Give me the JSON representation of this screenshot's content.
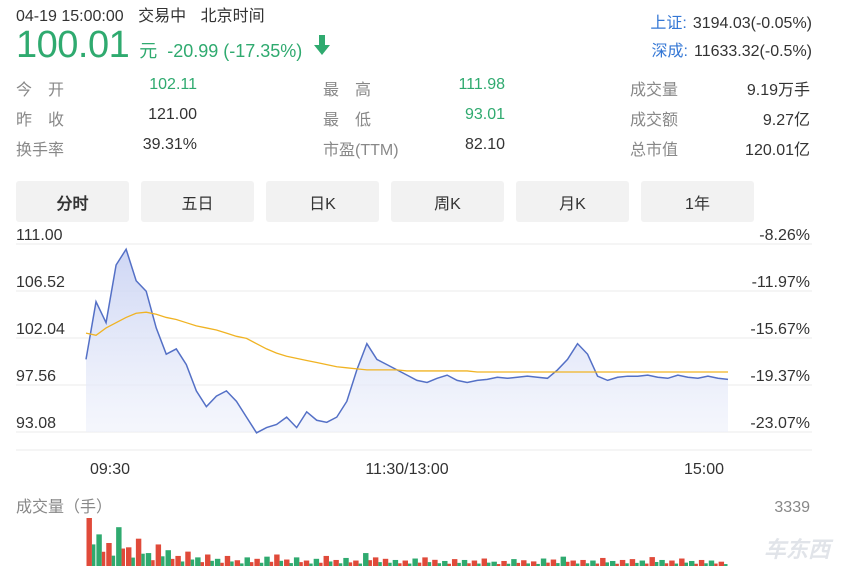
{
  "header": {
    "date_time": "04-19 15:00:00",
    "status": "交易中",
    "timezone": "北京时间",
    "price": "100.01",
    "unit": "元",
    "change": "-20.99 (-17.35%)"
  },
  "indices": [
    {
      "name": "上证:",
      "value": "3194.03(-0.05%)"
    },
    {
      "name": "深成:",
      "value": "11633.32(-0.5%)"
    }
  ],
  "stats": [
    {
      "label": "今　开",
      "value": "102.11",
      "color": "green"
    },
    {
      "label": "最　高",
      "value": "111.98",
      "color": "green"
    },
    {
      "label": "成交量",
      "value": "9.19万手",
      "color": "dark"
    },
    {
      "label": "昨　收",
      "value": "121.00",
      "color": "dark"
    },
    {
      "label": "最　低",
      "value": "93.01",
      "color": "green"
    },
    {
      "label": "成交额",
      "value": "9.27亿",
      "color": "dark"
    },
    {
      "label": "换手率",
      "value": "39.31%",
      "color": "dark"
    },
    {
      "label": "市盈(TTM)",
      "value": "82.10",
      "color": "dark"
    },
    {
      "label": "总市值",
      "value": "120.01亿",
      "color": "dark"
    }
  ],
  "tabs": [
    "分时",
    "五日",
    "日K",
    "周K",
    "月K",
    "1年"
  ],
  "active_tab": 0,
  "chart_data": {
    "type": "line",
    "y_left_ticks": [
      "111.00",
      "106.52",
      "102.04",
      "97.56",
      "93.08"
    ],
    "y_right_ticks": [
      "-8.26%",
      "-11.97%",
      "-15.67%",
      "-19.37%",
      "-23.07%"
    ],
    "ylim": [
      93.08,
      111.0
    ],
    "x_ticks": [
      "09:30",
      "11:30/13:00",
      "15:00"
    ],
    "series": [
      {
        "color": "#5470c6",
        "x": [
          0,
          1,
          2,
          3,
          4,
          5,
          6,
          7,
          8,
          9,
          10,
          11,
          12,
          13,
          14,
          15,
          16,
          17,
          18,
          19,
          20,
          21,
          22,
          23,
          24,
          25,
          26,
          27,
          28,
          29,
          30,
          31,
          32,
          33,
          34,
          35,
          36,
          37,
          38,
          39,
          40,
          41,
          42,
          43,
          44,
          45,
          46,
          47,
          48,
          49,
          50,
          51,
          52,
          53,
          54,
          55,
          56,
          57,
          58,
          59,
          60,
          61,
          62,
          63,
          64
        ],
        "y": [
          100.0,
          105.5,
          103.5,
          109.0,
          110.5,
          107.5,
          106.5,
          103.0,
          100.5,
          101.0,
          99.5,
          97.0,
          95.5,
          96.5,
          97.0,
          96.0,
          94.5,
          93.0,
          93.5,
          93.8,
          94.5,
          93.5,
          95.0,
          94.2,
          94.0,
          94.5,
          96.0,
          99.0,
          101.5,
          100.0,
          99.5,
          99.0,
          98.5,
          98.0,
          97.8,
          98.2,
          98.5,
          98.0,
          97.8,
          98.0,
          98.1,
          98.3,
          98.2,
          98.3,
          98.4,
          98.3,
          98.2,
          99.0,
          100.0,
          101.5,
          100.5,
          98.4,
          98.0,
          98.3,
          98.4,
          98.4,
          98.5,
          98.3,
          98.2,
          98.5,
          98.3,
          98.2,
          98.4,
          98.2,
          98.1
        ],
        "values_note_unit": "price"
      },
      {
        "color": "#f0b323",
        "x": [
          0,
          1,
          2,
          3,
          4,
          5,
          6,
          7,
          8,
          9,
          10,
          11,
          12,
          13,
          14,
          15,
          16,
          17,
          18,
          19,
          20,
          21,
          22,
          23,
          24,
          25,
          26,
          27,
          28,
          29,
          30,
          31,
          32,
          33,
          34,
          35,
          36,
          37,
          38,
          39,
          40,
          41,
          42,
          43,
          44,
          45,
          46,
          47,
          48,
          49,
          50,
          51,
          52,
          53,
          54,
          55,
          56,
          57,
          58,
          59,
          60,
          61,
          62,
          63,
          64
        ],
        "y": [
          102.5,
          102.3,
          103.0,
          103.5,
          104.0,
          104.4,
          104.5,
          104.3,
          104.0,
          103.8,
          103.5,
          103.2,
          103.0,
          102.8,
          102.5,
          102.2,
          102.0,
          101.5,
          101.0,
          100.6,
          100.3,
          100.1,
          99.9,
          99.7,
          99.5,
          99.3,
          99.2,
          99.1,
          99.0,
          99.0,
          99.0,
          99.0,
          98.9,
          98.9,
          98.9,
          98.9,
          98.9,
          98.9,
          98.9,
          98.8,
          98.8,
          98.8,
          98.8,
          98.8,
          98.8,
          98.8,
          98.8,
          98.8,
          98.8,
          98.8,
          98.8,
          98.8,
          98.8,
          98.8,
          98.8,
          98.8,
          98.8,
          98.8,
          98.8,
          98.8,
          98.8,
          98.8,
          98.8,
          98.8,
          98.8
        ]
      }
    ],
    "volume": {
      "label": "成交量（手）",
      "max_label": "3339",
      "max": 3339,
      "values": [
        3339,
        2200,
        1600,
        2700,
        1300,
        1900,
        900,
        1500,
        1100,
        700,
        1000,
        600,
        800,
        500,
        700,
        400,
        600,
        500,
        650,
        800,
        450,
        600,
        380,
        500,
        700,
        420,
        560,
        380,
        900,
        600,
        500,
        420,
        380,
        520,
        600,
        430,
        350,
        480,
        420,
        380,
        520,
        300,
        350,
        480,
        400,
        320,
        520,
        450,
        650,
        380,
        420,
        380,
        560,
        350,
        420,
        480,
        380,
        620,
        420,
        380,
        520,
        350,
        420,
        380,
        300
      ],
      "colors_pattern": [
        "#e04a3a",
        "#2faa6f",
        "#e04a3a",
        "#2faa6f",
        "#e04a3a"
      ]
    }
  },
  "watermark": "车东西"
}
